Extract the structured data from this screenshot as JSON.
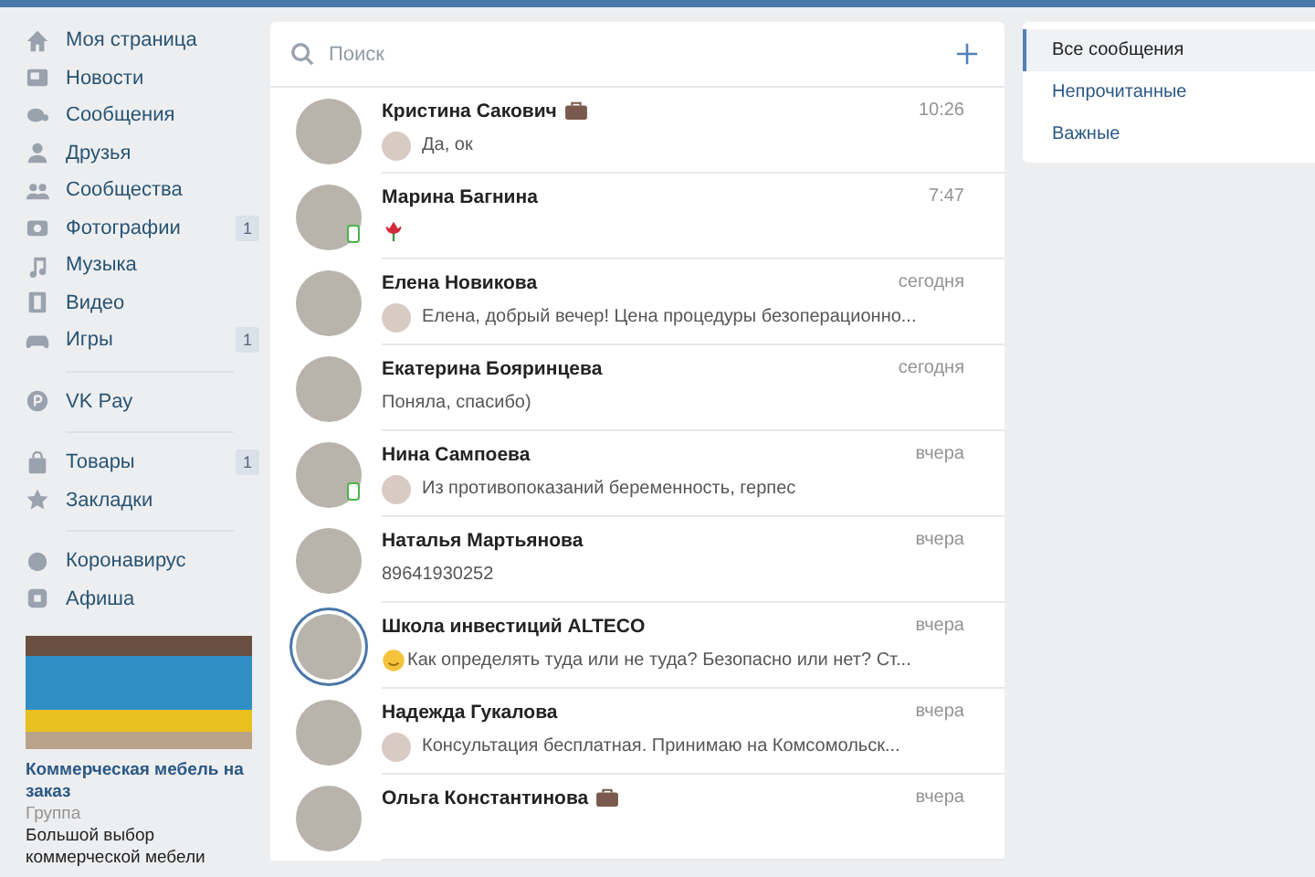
{
  "sidebar": {
    "groups": [
      [
        {
          "kind": "home",
          "label": "Моя страница"
        },
        {
          "kind": "news",
          "label": "Новости"
        },
        {
          "kind": "chat",
          "label": "Сообщения"
        },
        {
          "kind": "user",
          "label": "Друзья"
        },
        {
          "kind": "users",
          "label": "Сообщества"
        },
        {
          "kind": "camera",
          "label": "Фотографии",
          "count": "1"
        },
        {
          "kind": "note",
          "label": "Музыка"
        },
        {
          "kind": "film",
          "label": "Видео"
        },
        {
          "kind": "gamepad",
          "label": "Игры",
          "count": "1"
        }
      ],
      [
        {
          "kind": "coin",
          "label": "VK Pay"
        }
      ],
      [
        {
          "kind": "bag",
          "label": "Товары",
          "count": "1"
        },
        {
          "kind": "star",
          "label": "Закладки"
        }
      ],
      [
        {
          "kind": "dot",
          "label": "Коронавирус"
        },
        {
          "kind": "square",
          "label": "Афиша"
        }
      ]
    ],
    "ad": {
      "title": "Коммерческая мебель на заказ",
      "subtitle": "Группа",
      "text": "Большой выбор коммерческой мебели"
    }
  },
  "search": {
    "placeholder": "Поиск"
  },
  "dialogs": [
    {
      "name": "Кристина Сакович",
      "work_badge": true,
      "time": "10:26",
      "own_avatar": true,
      "preview": "Да, ок",
      "online_mobile": false,
      "story_ring": false
    },
    {
      "name": "Марина Багнина",
      "work_badge": false,
      "time": "7:47",
      "own_avatar": false,
      "preview_parts": [
        {
          "kind": "rose"
        }
      ],
      "online_mobile": true,
      "story_ring": false
    },
    {
      "name": "Елена Новикова",
      "work_badge": false,
      "time": "сегодня",
      "own_avatar": true,
      "preview": "Елена, добрый вечер! Цена процедуры безоперационно...",
      "online_mobile": false,
      "story_ring": false
    },
    {
      "name": "Екатерина Бояринцева",
      "work_badge": false,
      "time": "сегодня",
      "own_avatar": false,
      "preview": "Поняла, спасибо)",
      "online_mobile": false,
      "story_ring": false
    },
    {
      "name": "Нина Сампоева",
      "work_badge": false,
      "time": "вчера",
      "own_avatar": true,
      "preview": "Из противопоказаний беременность, герпес",
      "online_mobile": true,
      "story_ring": false
    },
    {
      "name": "Наталья Мартьянова",
      "work_badge": false,
      "time": "вчера",
      "own_avatar": false,
      "preview": "89641930252",
      "online_mobile": false,
      "story_ring": false
    },
    {
      "name": "Школа инвестиций ALTECO",
      "work_badge": false,
      "time": "вчера",
      "own_avatar": false,
      "preview_parts": [
        {
          "kind": "smile"
        }
      ],
      "preview": "Как определять туда или не туда? Безопасно или нет? Ст...",
      "online_mobile": false,
      "story_ring": true
    },
    {
      "name": "Надежда Гукалова",
      "work_badge": false,
      "time": "вчера",
      "own_avatar": true,
      "preview": "Консультация бесплатная. Принимаю на Комсомольск...",
      "online_mobile": false,
      "story_ring": false
    },
    {
      "name": "Ольга Константинова",
      "work_badge": true,
      "time": "вчера",
      "own_avatar": false,
      "online_mobile": false,
      "story_ring": false
    }
  ],
  "filters": [
    {
      "label": "Все сообщения",
      "selected": true
    },
    {
      "label": "Непрочитанные",
      "selected": false
    },
    {
      "label": "Важные",
      "selected": false
    }
  ]
}
